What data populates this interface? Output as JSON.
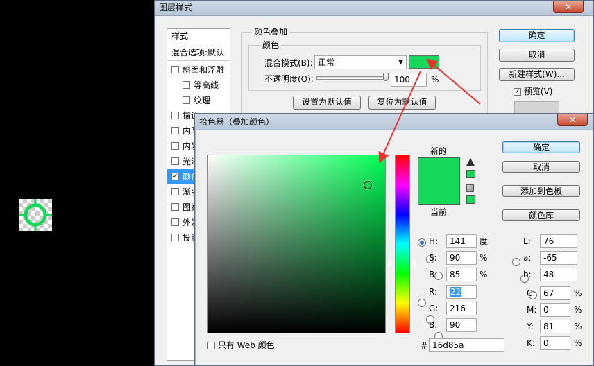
{
  "layer_style": {
    "title": "图层样式",
    "close": "✕",
    "styles_header": "样式",
    "blend_options": "混合选项:默认",
    "effects": [
      {
        "label": "斜面和浮雕",
        "checked": false,
        "indent": false
      },
      {
        "label": "等高线",
        "checked": false,
        "indent": true
      },
      {
        "label": "纹理",
        "checked": false,
        "indent": true
      },
      {
        "label": "描边",
        "checked": false,
        "indent": false
      },
      {
        "label": "内阴",
        "checked": false,
        "indent": false
      },
      {
        "label": "内发",
        "checked": false,
        "indent": false
      },
      {
        "label": "光泽",
        "checked": false,
        "indent": false
      },
      {
        "label": "颜色",
        "checked": true,
        "indent": false
      },
      {
        "label": "渐变",
        "checked": false,
        "indent": false
      },
      {
        "label": "图案",
        "checked": false,
        "indent": false
      },
      {
        "label": "外发",
        "checked": false,
        "indent": false
      },
      {
        "label": "投影",
        "checked": false,
        "indent": false
      }
    ],
    "section_title": "颜色叠加",
    "subsection_title": "颜色",
    "blend_mode_label": "混合模式(B):",
    "blend_mode_value": "正常",
    "overlay_color": "#16d85a",
    "opacity_label": "不透明度(O):",
    "opacity_value": "100",
    "opacity_unit": "%",
    "set_default": "设置为默认值",
    "reset_default": "复位为默认值",
    "ok": "确定",
    "cancel": "取消",
    "new_style": "新建样式(W)...",
    "preview_label": "预览(V)",
    "preview_checked": true
  },
  "color_picker": {
    "title": "拾色器（叠加颜色）",
    "close": "✕",
    "new_label": "新的",
    "current_label": "当前",
    "new_color": "#16d85a",
    "current_color": "#16d85a",
    "hue_color": "#00ff55",
    "ok": "确定",
    "cancel": "取消",
    "add_to_swatches": "添加到色板",
    "color_libraries": "颜色库",
    "web_only_label": "只有 Web 颜色",
    "hsb": [
      {
        "key": "H:",
        "value": "141",
        "unit": "度",
        "selected": true
      },
      {
        "key": "S:",
        "value": "90",
        "unit": "%",
        "selected": false
      },
      {
        "key": "B:",
        "value": "85",
        "unit": "%",
        "selected": false
      }
    ],
    "rgb": [
      {
        "key": "R:",
        "value": "22",
        "selected": false
      },
      {
        "key": "G:",
        "value": "216",
        "selected": false
      },
      {
        "key": "B:",
        "value": "90",
        "selected": false
      }
    ],
    "lab": [
      {
        "key": "L:",
        "value": "76"
      },
      {
        "key": "a:",
        "value": "-65"
      },
      {
        "key": "b:",
        "value": "48"
      }
    ],
    "cmyk": [
      {
        "key": "C:",
        "value": "67",
        "unit": "%"
      },
      {
        "key": "M:",
        "value": "0",
        "unit": "%"
      },
      {
        "key": "Y:",
        "value": "81",
        "unit": "%"
      },
      {
        "key": "K:",
        "value": "0",
        "unit": "%"
      }
    ],
    "hex_label": "#",
    "hex_value": "16d85a"
  },
  "canvas": {
    "ring_color": "#16d85a"
  }
}
